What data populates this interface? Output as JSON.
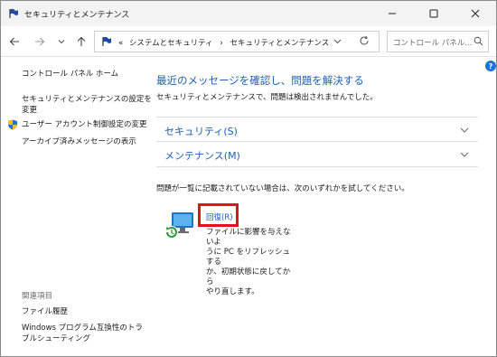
{
  "window": {
    "title": "セキュリティとメンテナンス",
    "minimize_icon": "minimize-icon",
    "maximize_icon": "maximize-icon",
    "close_icon": "close-icon"
  },
  "navigation": {
    "back_icon": "arrow-left-icon",
    "forward_icon": "arrow-right-icon",
    "recent_icon": "chevron-down-icon",
    "up_icon": "arrow-up-icon"
  },
  "address": {
    "prefix": "«",
    "crumb1": "システムとセキュリティ",
    "separator": "›",
    "crumb2": "セキュリティとメンテナンス"
  },
  "search": {
    "placeholder": "コントロール パネル..."
  },
  "help": {
    "label": "?"
  },
  "left_pane": {
    "home": "コントロール パネル ホーム",
    "settings_line1": "セキュリティとメンテナンスの設定を",
    "settings_line2": "変更",
    "uac": "ユーザー アカウント制御設定の変更",
    "archived": "アーカイブ済みメッセージの表示",
    "related_heading": "関連項目",
    "file_history": "ファイル履歴",
    "compat_line1": "Windows プログラム互換性のトラ",
    "compat_line2": "ブルシューティング"
  },
  "main": {
    "title": "最近のメッセージを確認し、問題を解決する",
    "subtitle": "セキュリティとメンテナンスで、問題は検出されませんでした。",
    "sections": [
      {
        "label": "セキュリティ(S)"
      },
      {
        "label": "メンテナンス(M)"
      }
    ],
    "hint": "問題が一覧に記載されていない場合は、次のいずれかを試してください。",
    "recovery": {
      "link": "回復(R)",
      "desc_line1": "ファイルに影響を与えないよ",
      "desc_line2": "うに PC をリフレッシュする",
      "desc_line3": "か、初期状態に戻してから",
      "desc_line4": "やり直します。"
    }
  },
  "colors": {
    "link": "#1e5fb3",
    "highlight": "#e0121d",
    "titlebar": "#f3f3f3"
  }
}
